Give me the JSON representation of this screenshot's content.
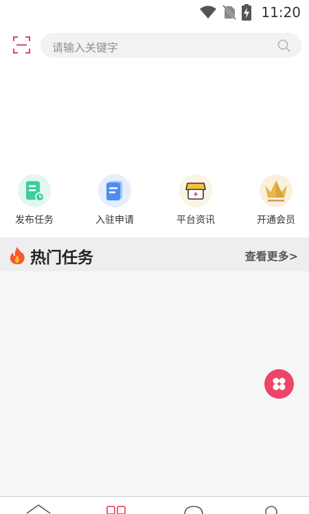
{
  "status_bar": {
    "time": "11:20",
    "icons": [
      "wifi-icon",
      "no-sim-icon",
      "battery-charging-icon"
    ]
  },
  "search": {
    "placeholder": "请输入关键字",
    "scan_icon": "scan-icon",
    "search_icon": "search-icon"
  },
  "menu": {
    "items": [
      {
        "label": "发布任务",
        "icon": "publish-task-icon",
        "color": "#3ccf9e"
      },
      {
        "label": "入驻申请",
        "icon": "apply-document-icon",
        "color": "#4c8df2"
      },
      {
        "label": "平台资讯",
        "icon": "store-awning-icon",
        "color": "#f5c03a"
      },
      {
        "label": "开通会员",
        "icon": "crown-icon",
        "color": "#e7b64a"
      }
    ]
  },
  "hot_section": {
    "title": "热门任务",
    "more": "查看更多>",
    "icon": "flame-icon"
  },
  "fab": {
    "icon": "four-dots-icon",
    "color": "#ec4569"
  },
  "bottom_nav": {
    "items": [
      "home-icon",
      "grid-icon",
      "message-icon",
      "profile-icon"
    ],
    "active_color": "#ec4569"
  },
  "colors": {
    "accent": "#ec4569",
    "section_bg": "#eeeeee",
    "content_bg": "#f6f6f6"
  }
}
